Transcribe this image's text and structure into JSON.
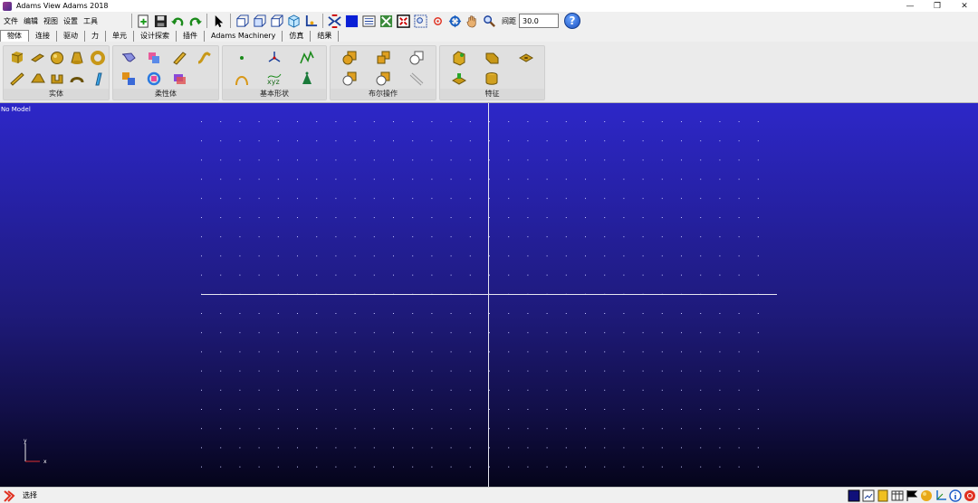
{
  "window": {
    "title": "Adams View Adams 2018"
  },
  "menu": [
    "文件",
    "编辑",
    "视图",
    "设置",
    "工具"
  ],
  "toolbar": {
    "spacing_label": "间距",
    "spacing_value": "30.0",
    "help_label": "?"
  },
  "tabs": [
    "物体",
    "连接",
    "驱动",
    "力",
    "单元",
    "设计探索",
    "插件",
    "Adams Machinery",
    "仿真",
    "结果"
  ],
  "active_tab": "物体",
  "ribbon": {
    "groups": [
      {
        "label": "实体"
      },
      {
        "label": "柔性体"
      },
      {
        "label": "基本形状"
      },
      {
        "label": "布尔操作"
      },
      {
        "label": "特征"
      }
    ]
  },
  "viewport": {
    "model_label": "No Model",
    "triad_x": "x",
    "triad_y": "y"
  },
  "status": {
    "text": "选择"
  },
  "colors": {
    "accent_tab": "#ffffff",
    "viewport_top": "#2d27c8",
    "viewport_bottom": "#05041a"
  }
}
